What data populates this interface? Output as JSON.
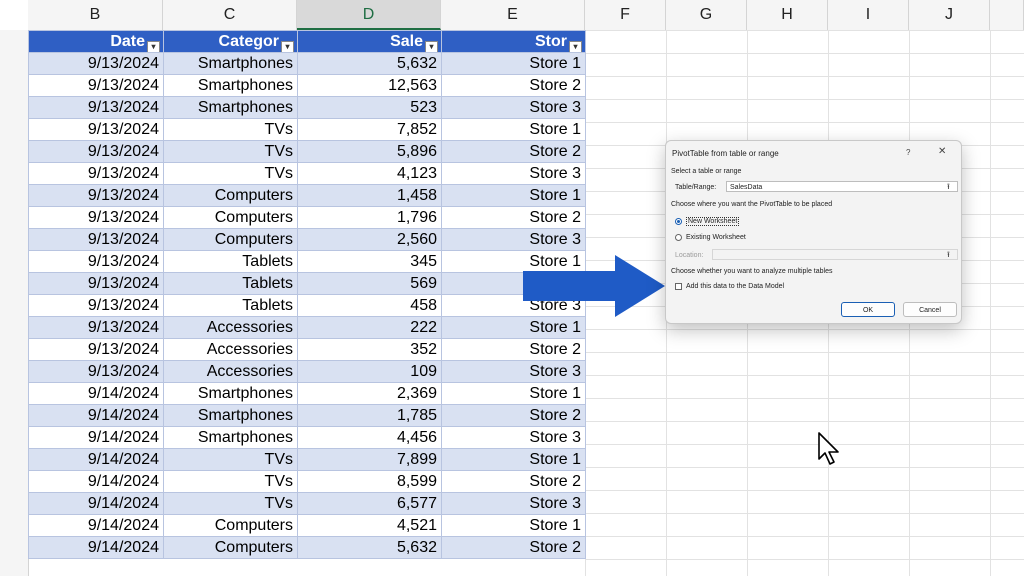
{
  "columns": [
    {
      "letter": "B"
    },
    {
      "letter": "C"
    },
    {
      "letter": "D"
    },
    {
      "letter": "E"
    },
    {
      "letter": "F"
    },
    {
      "letter": "G"
    },
    {
      "letter": "H"
    },
    {
      "letter": "I"
    },
    {
      "letter": "J"
    }
  ],
  "table": {
    "headers": [
      "Date",
      "Categor",
      "Sale",
      "Stor"
    ],
    "rows": [
      [
        "9/13/2024",
        "Smartphones",
        "5,632",
        "Store 1"
      ],
      [
        "9/13/2024",
        "Smartphones",
        "12,563",
        "Store 2"
      ],
      [
        "9/13/2024",
        "Smartphones",
        "523",
        "Store 3"
      ],
      [
        "9/13/2024",
        "TVs",
        "7,852",
        "Store 1"
      ],
      [
        "9/13/2024",
        "TVs",
        "5,896",
        "Store 2"
      ],
      [
        "9/13/2024",
        "TVs",
        "4,123",
        "Store 3"
      ],
      [
        "9/13/2024",
        "Computers",
        "1,458",
        "Store 1"
      ],
      [
        "9/13/2024",
        "Computers",
        "1,796",
        "Store 2"
      ],
      [
        "9/13/2024",
        "Computers",
        "2,560",
        "Store 3"
      ],
      [
        "9/13/2024",
        "Tablets",
        "345",
        "Store 1"
      ],
      [
        "9/13/2024",
        "Tablets",
        "569",
        ""
      ],
      [
        "9/13/2024",
        "Tablets",
        "458",
        "Store 3"
      ],
      [
        "9/13/2024",
        "Accessories",
        "222",
        "Store 1"
      ],
      [
        "9/13/2024",
        "Accessories",
        "352",
        "Store 2"
      ],
      [
        "9/13/2024",
        "Accessories",
        "109",
        "Store 3"
      ],
      [
        "9/14/2024",
        "Smartphones",
        "2,369",
        "Store 1"
      ],
      [
        "9/14/2024",
        "Smartphones",
        "1,785",
        "Store 2"
      ],
      [
        "9/14/2024",
        "Smartphones",
        "4,456",
        "Store 3"
      ],
      [
        "9/14/2024",
        "TVs",
        "7,899",
        "Store 1"
      ],
      [
        "9/14/2024",
        "TVs",
        "8,599",
        "Store 2"
      ],
      [
        "9/14/2024",
        "TVs",
        "6,577",
        "Store 3"
      ],
      [
        "9/14/2024",
        "Computers",
        "4,521",
        "Store 1"
      ],
      [
        "9/14/2024",
        "Computers",
        "5,632",
        "Store 2"
      ]
    ]
  },
  "dialog": {
    "title": "PivotTable from table or range",
    "help": "?",
    "close": "✕",
    "select_label": "Select a table or range",
    "range_label": "Table/Range:",
    "range_value": "SalesData",
    "placement_label": "Choose where you want the PivotTable to be placed",
    "new_worksheet": "New Worksheet",
    "existing_worksheet": "Existing Worksheet",
    "location_label": "Location:",
    "multiple_label": "Choose whether you want to analyze multiple tables",
    "data_model_label": "Add this data to the Data Model",
    "ok": "OK",
    "cancel": "Cancel"
  },
  "colors": {
    "header_blue": "#2f5fc4",
    "band": "#d9e1f2",
    "arrow": "#1f5bc6"
  }
}
